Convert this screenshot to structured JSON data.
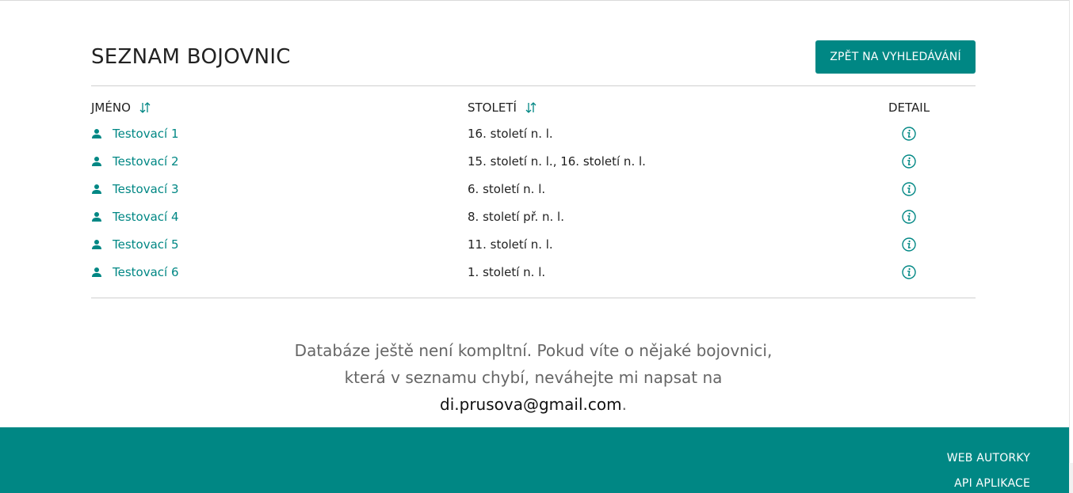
{
  "header": {
    "title": "SEZNAM BOJOVNIC",
    "back_button": "ZPĚT NA VYHLEDÁVÁNÍ"
  },
  "table": {
    "columns": {
      "name": "JMÉNO",
      "century": "STOLETÍ",
      "detail": "DETAIL"
    },
    "rows": [
      {
        "name": "Testovací 1",
        "century": "16. století n. l."
      },
      {
        "name": "Testovací 2",
        "century": "15. století n. l., 16. století n. l."
      },
      {
        "name": "Testovací 3",
        "century": "6. století n. l."
      },
      {
        "name": "Testovací 4",
        "century": "8. století př. n. l."
      },
      {
        "name": "Testovací 5",
        "century": "11. století n. l."
      },
      {
        "name": "Testovací 6",
        "century": "1. století n. l."
      }
    ]
  },
  "notice": {
    "text_before": "Databáze ještě není kompltní. Pokud víte o nějaké bojovnici, která v seznamu chybí, neváhejte mi napsat na ",
    "email": "di.prusova@gmail.com",
    "text_after": "."
  },
  "footer": {
    "web_link": "WEB AUTORKY",
    "api_link": "API APLIKACE"
  },
  "colors": {
    "accent": "#008784"
  },
  "icons": {
    "sort": "sort-arrows-icon",
    "user": "user-icon",
    "info": "info-circle-icon"
  }
}
